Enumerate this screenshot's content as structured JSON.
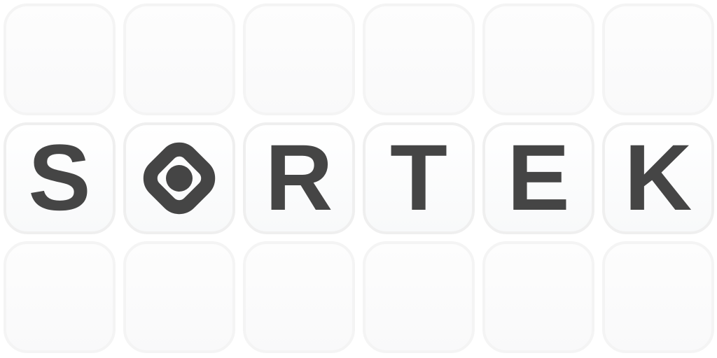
{
  "logo": {
    "wordmark": "SORTEK",
    "letters": [
      "S",
      "R",
      "T",
      "E",
      "K"
    ],
    "o_icon": "rounded-diamond-target-icon",
    "colors": {
      "letter": "#454545",
      "tile_border": "#efefef",
      "tile_fill": "#f8f9fa"
    }
  }
}
